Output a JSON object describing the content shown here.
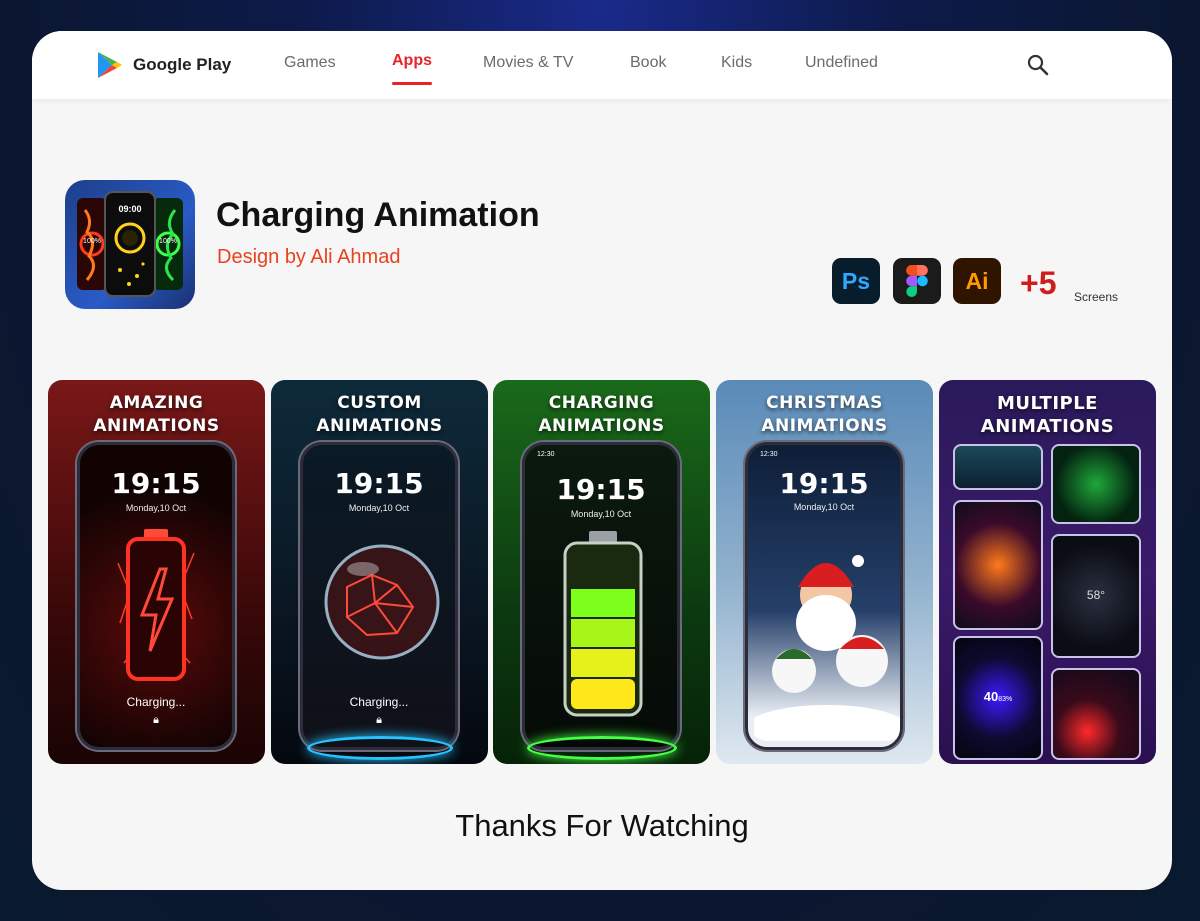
{
  "nav": {
    "brand": "Google Play",
    "items": [
      {
        "label": "Games",
        "active": false
      },
      {
        "label": "Apps",
        "active": true
      },
      {
        "label": "Movies & TV",
        "active": false
      },
      {
        "label": "Book",
        "active": false
      },
      {
        "label": "Kids",
        "active": false
      },
      {
        "label": "Undefined",
        "active": false
      }
    ],
    "search_icon": "search-icon",
    "accent_color": "#e8232a"
  },
  "app": {
    "title": "Charging Animation",
    "subtitle": "Design by Ali Ahmad",
    "icon_clock": "09:00",
    "icon_left_percent": "100%",
    "icon_right_percent": "100%"
  },
  "tools": {
    "ps_label": "Ps",
    "ai_label": "Ai",
    "figma_icon": "figma-icon",
    "count": "+5",
    "count_unit": "Screens"
  },
  "screenshots": [
    {
      "caption_1": "AMAZING",
      "caption_2": "ANIMATIONS",
      "clock": "19:15",
      "date": "Monday,10 Oct",
      "status": "Charging..."
    },
    {
      "caption_1": "CUSTOM",
      "caption_2": "ANIMATIONS",
      "clock": "19:15",
      "date": "Monday,10 Oct",
      "status": "Charging..."
    },
    {
      "caption_1": "CHARGING",
      "caption_2": "ANIMATIONS",
      "clock": "19:15",
      "date": "Monday,10 Oct",
      "status_time": "12:30"
    },
    {
      "caption_1": "CHRISTMAS",
      "caption_2": "ANIMATIONS",
      "clock": "19:15",
      "date": "Monday,10 Oct",
      "status_time": "12:30"
    },
    {
      "caption_1": "MULTIPLE",
      "caption_2": "ANIMATIONS",
      "tile_temp": "58°",
      "tile_percent": "40",
      "tile_percent_unit": "83%"
    }
  ],
  "footer": {
    "text": "Thanks For Watching"
  }
}
